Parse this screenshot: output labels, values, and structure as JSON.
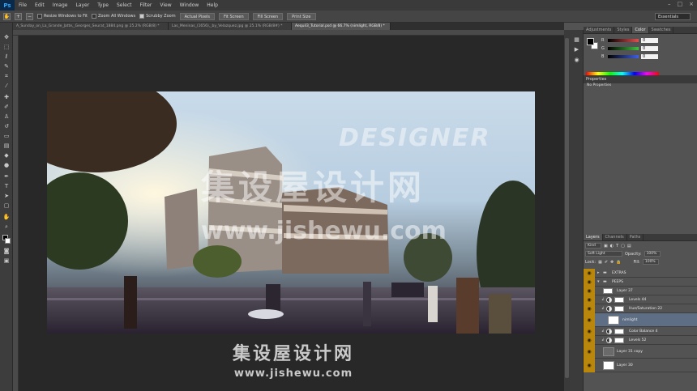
{
  "app": {
    "logo": "Ps",
    "window_controls": [
      "–",
      "□",
      "×"
    ]
  },
  "menu": [
    "File",
    "Edit",
    "Image",
    "Layer",
    "Type",
    "Select",
    "Filter",
    "View",
    "Window",
    "Help"
  ],
  "options": {
    "tool_icons": [
      "hand-icon",
      "zoom-in-icon",
      "zoom-out-icon"
    ],
    "checks": [
      {
        "label": "Resize Windows to Fit",
        "checked": false
      },
      {
        "label": "Zoom All Windows",
        "checked": false
      },
      {
        "label": "Scrubby Zoom",
        "checked": true
      }
    ],
    "buttons": [
      "Actual Pixels",
      "Fit Screen",
      "Fill Screen",
      "Print Size"
    ],
    "workspace": "Essentials"
  },
  "tabs": [
    {
      "label": "A_Sunday_on_La_Grande_Jatte,_Georges_Seurat_1884.png @ 25.2% (RGB/8) *",
      "active": false
    },
    {
      "label": "Las_Meninas_(1656),_by_Velazquez.jpg @ 25.1% (RGB/8#) *",
      "active": false
    },
    {
      "label": "Aequil3_Tutorial.psd @ 66.7% (nimlight, RGB/8) *",
      "active": true
    }
  ],
  "artwork": {
    "watermark_top": "DESIGNER",
    "watermark_cn": "集设屋设计网",
    "watermark_url": "www.jishewu.com",
    "footer_cn": "集设屋设计网",
    "footer_url": "www.jishewu.com"
  },
  "color_panel": {
    "tabs": [
      {
        "label": "Adjustments",
        "active": false
      },
      {
        "label": "Styles",
        "active": false
      },
      {
        "label": "Color",
        "active": true
      },
      {
        "label": "Swatches",
        "active": false
      }
    ],
    "channels": [
      {
        "label": "R",
        "value": "0",
        "color": "#e05050"
      },
      {
        "label": "G",
        "value": "0",
        "color": "#40c040"
      },
      {
        "label": "B",
        "value": "0",
        "color": "#4060e0"
      }
    ]
  },
  "properties": {
    "title": "Properties",
    "empty": "No Properties"
  },
  "layers_panel": {
    "tabs": [
      {
        "label": "Layers",
        "active": true
      },
      {
        "label": "Channels",
        "active": false
      },
      {
        "label": "Paths",
        "active": false
      }
    ],
    "kind": "Kind",
    "blend_mode": "Soft Light",
    "opacity_label": "Opacity:",
    "opacity": "100%",
    "lock_label": "Lock:",
    "fill_label": "Fill:",
    "fill": "100%",
    "layers": [
      {
        "name": "EXTRAS",
        "kind": "group",
        "indent": 0,
        "selected": false
      },
      {
        "name": "PEEPS",
        "kind": "group-open",
        "indent": 0,
        "selected": false
      },
      {
        "name": "Layer 37",
        "kind": "pixel",
        "indent": 1,
        "selected": false
      },
      {
        "name": "Levels 44",
        "kind": "adjust",
        "indent": 2,
        "selected": false
      },
      {
        "name": "Hue/Saturation 22",
        "kind": "adjust",
        "indent": 2,
        "selected": false
      },
      {
        "name": "nimlight",
        "kind": "pixel",
        "indent": 1,
        "selected": true
      },
      {
        "name": "Color Balance 4",
        "kind": "adjust",
        "indent": 2,
        "selected": false
      },
      {
        "name": "Levels 52",
        "kind": "adjust",
        "indent": 2,
        "selected": false
      },
      {
        "name": "Layer 31 copy",
        "kind": "pixel",
        "indent": 1,
        "selected": false
      },
      {
        "name": "Layer 30",
        "kind": "pixel",
        "indent": 1,
        "selected": false
      }
    ]
  }
}
